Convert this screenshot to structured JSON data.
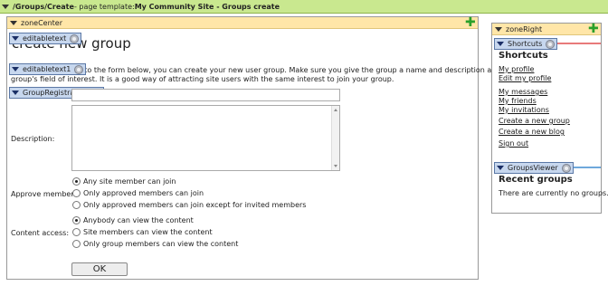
{
  "topbar": {
    "path": "/Groups/Create",
    "template_prefix": " - page template: ",
    "template": "My Community Site - Groups create"
  },
  "zone_center": {
    "label": "zoneCenter"
  },
  "zone_right": {
    "label": "zoneRight"
  },
  "webparts": {
    "editabletext": "editabletext",
    "editabletext1": "editabletext1",
    "group_registration": "GroupRegistration",
    "shortcuts": "Shortcuts",
    "groups_viewer": "GroupsViewer"
  },
  "main": {
    "heading_visible": "create new group",
    "intro_line1": "into the form below, you can create your new user group. Make sure you give the group a name and description according to the",
    "intro_line2": "group's field of interest. It is a good way of attracting site users with the same interest to join your group.",
    "description_label": "Description:",
    "approve_label": "Approve members:",
    "approve_options": [
      "Any site member can join",
      "Only approved members can join",
      "Only approved members can join except for invited members"
    ],
    "access_label": "Content access:",
    "access_options": [
      "Anybody can view the content",
      "Site members can view the content",
      "Only group members can view the content"
    ],
    "ok_button": "OK"
  },
  "sidebar": {
    "shortcuts_title": "Shortcuts",
    "links": [
      "My profile",
      "Edit my profile",
      "My messages",
      "My friends",
      "My invitations",
      "Create a new group",
      "Create a new blog",
      "Sign out"
    ],
    "recent_title": "Recent groups",
    "recent_empty": "There are currently no groups."
  },
  "colors": {
    "topbar_bg": "#c9e88f",
    "zone_header_bg": "#ffe6a8",
    "webpart_tag_bg": "#c7d7ee",
    "shortcuts_accent": "#e87a7a",
    "groupsviewer_accent": "#6fa8dc"
  }
}
